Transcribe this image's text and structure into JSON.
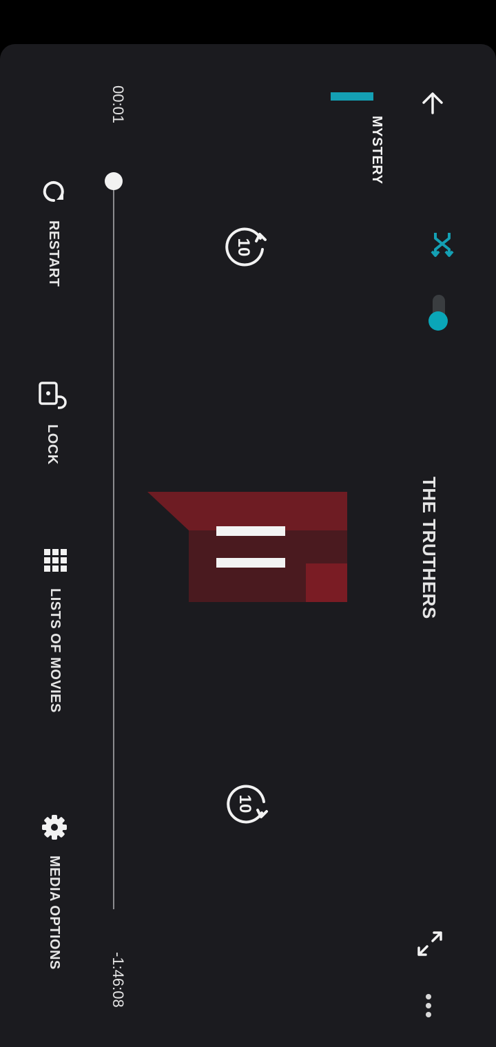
{
  "header": {
    "title": "THE TRUTHERS",
    "genre_tab": "MYSTERY",
    "accent_color": "#14a0b4"
  },
  "icons": {
    "back": "arrow-up-icon",
    "shuffle": "shuffle-icon",
    "toggle": "toggle-switch-on",
    "fullscreen": "expand-icon",
    "more": "more-dots-icon",
    "replay": "replay-10-icon",
    "forward": "forward-10-icon",
    "pause": "pause-icon"
  },
  "player": {
    "skip_seconds": "10",
    "elapsed": "00:01",
    "remaining": "-1:46:08",
    "progress_fraction": 0.0
  },
  "controls": {
    "restart": "RESTART",
    "lock": "LOCK",
    "lists": "LISTS OF MOVIES",
    "media": "MEDIA OPTIONS"
  }
}
